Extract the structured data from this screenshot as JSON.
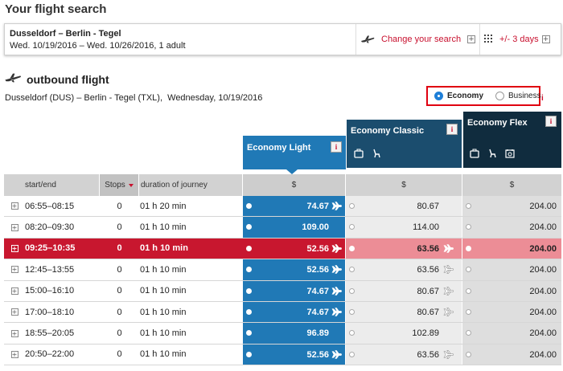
{
  "page": {
    "title": "Your flight search"
  },
  "search": {
    "route": "Dusseldorf – Berlin - Tegel",
    "dates": "Wed. 10/19/2016 – Wed. 10/26/2016, 1 adult",
    "change_label": "Change your search",
    "days_label": "+/- 3 days"
  },
  "outbound": {
    "title": "outbound flight",
    "route": "Dusseldorf (DUS) – Berlin - Tegel (TXL),  Wednesday, 10/19/2016"
  },
  "cabin": {
    "options": [
      {
        "label": "Economy",
        "selected": true
      },
      {
        "label": "Business",
        "selected": false
      }
    ],
    "info": "i"
  },
  "fares": [
    {
      "name": "Economy Light",
      "info": "i",
      "color": "#2079b6"
    },
    {
      "name": "Economy Classic",
      "info": "i",
      "color": "#1b4d6e",
      "features": [
        "suitcase-icon",
        "seat-icon"
      ]
    },
    {
      "name": "Economy Flex",
      "info": "i",
      "color": "#102c3e",
      "features": [
        "suitcase-icon",
        "seat-icon",
        "rebook-icon"
      ]
    }
  ],
  "table": {
    "headers": {
      "start": "start/end",
      "stops": "Stops",
      "duration": "duration of journey",
      "price1": "$",
      "price2": "$",
      "price3": "$"
    },
    "rows": [
      {
        "expand": "+",
        "time": "06:55–08:15",
        "stops": "0",
        "duration": "01 h 20 min",
        "p1": "74.67",
        "p1_cheapest": true,
        "p2": "80.67",
        "p2_cheapest": false,
        "p3": "204.00",
        "selected": false
      },
      {
        "expand": "+",
        "time": "08:20–09:30",
        "stops": "0",
        "duration": "01 h 10 min",
        "p1": "109.00",
        "p1_cheapest": false,
        "p2": "114.00",
        "p2_cheapest": false,
        "p3": "204.00",
        "selected": false
      },
      {
        "expand": "+",
        "time": "09:25–10:35",
        "stops": "0",
        "duration": "01 h 10 min",
        "p1": "52.56",
        "p1_cheapest": true,
        "p2": "63.56",
        "p2_cheapest": true,
        "p3": "204.00",
        "selected": true
      },
      {
        "expand": "+",
        "time": "12:45–13:55",
        "stops": "0",
        "duration": "01 h 10 min",
        "p1": "52.56",
        "p1_cheapest": true,
        "p2": "63.56",
        "p2_cheapest": true,
        "p3": "204.00",
        "selected": false
      },
      {
        "expand": "+",
        "time": "15:00–16:10",
        "stops": "0",
        "duration": "01 h 10 min",
        "p1": "74.67",
        "p1_cheapest": true,
        "p2": "80.67",
        "p2_cheapest": true,
        "p3": "204.00",
        "selected": false
      },
      {
        "expand": "+",
        "time": "17:00–18:10",
        "stops": "0",
        "duration": "01 h 10 min",
        "p1": "74.67",
        "p1_cheapest": true,
        "p2": "80.67",
        "p2_cheapest": true,
        "p3": "204.00",
        "selected": false
      },
      {
        "expand": "+",
        "time": "18:55–20:05",
        "stops": "0",
        "duration": "01 h 10 min",
        "p1": "96.89",
        "p1_cheapest": false,
        "p2": "102.89",
        "p2_cheapest": false,
        "p3": "204.00",
        "selected": false
      },
      {
        "expand": "+",
        "time": "20:50–22:00",
        "stops": "0",
        "duration": "01 h 10 min",
        "p1": "52.56",
        "p1_cheapest": true,
        "p2": "63.56",
        "p2_cheapest": true,
        "p3": "204.00",
        "selected": false
      }
    ]
  },
  "colors": {
    "accent": "#c8102e",
    "light_fare": "#2079b6",
    "selected_row": "#c8172f"
  }
}
